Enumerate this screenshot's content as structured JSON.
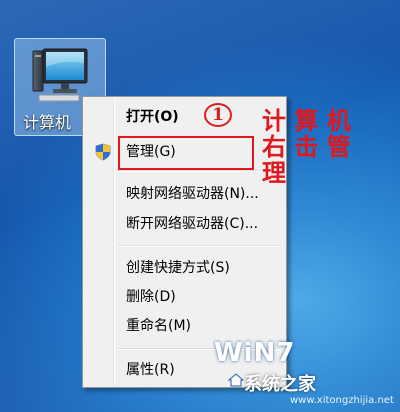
{
  "desktop": {
    "icon_label": "计算机",
    "icon_name": "computer-icon"
  },
  "context_menu": {
    "items": [
      {
        "label": "打开(O)",
        "bold": true
      },
      {
        "label": "管理(G)",
        "icon": "uac-shield-icon"
      },
      {
        "label": "映射网络驱动器(N)..."
      },
      {
        "label": "断开网络驱动器(C)..."
      },
      {
        "label": "创建快捷方式(S)"
      },
      {
        "label": "删除(D)"
      },
      {
        "label": "重命名(M)"
      },
      {
        "label": "属性(R)"
      }
    ]
  },
  "annotation": {
    "step_number": "1",
    "text_lines": [
      "计 算 机",
      "右 击 管",
      "理"
    ],
    "color": "#e0181e"
  },
  "watermark": {
    "brand": "WiN7",
    "site_name": "系统之家",
    "url": "www.xitongzhijia.net"
  }
}
